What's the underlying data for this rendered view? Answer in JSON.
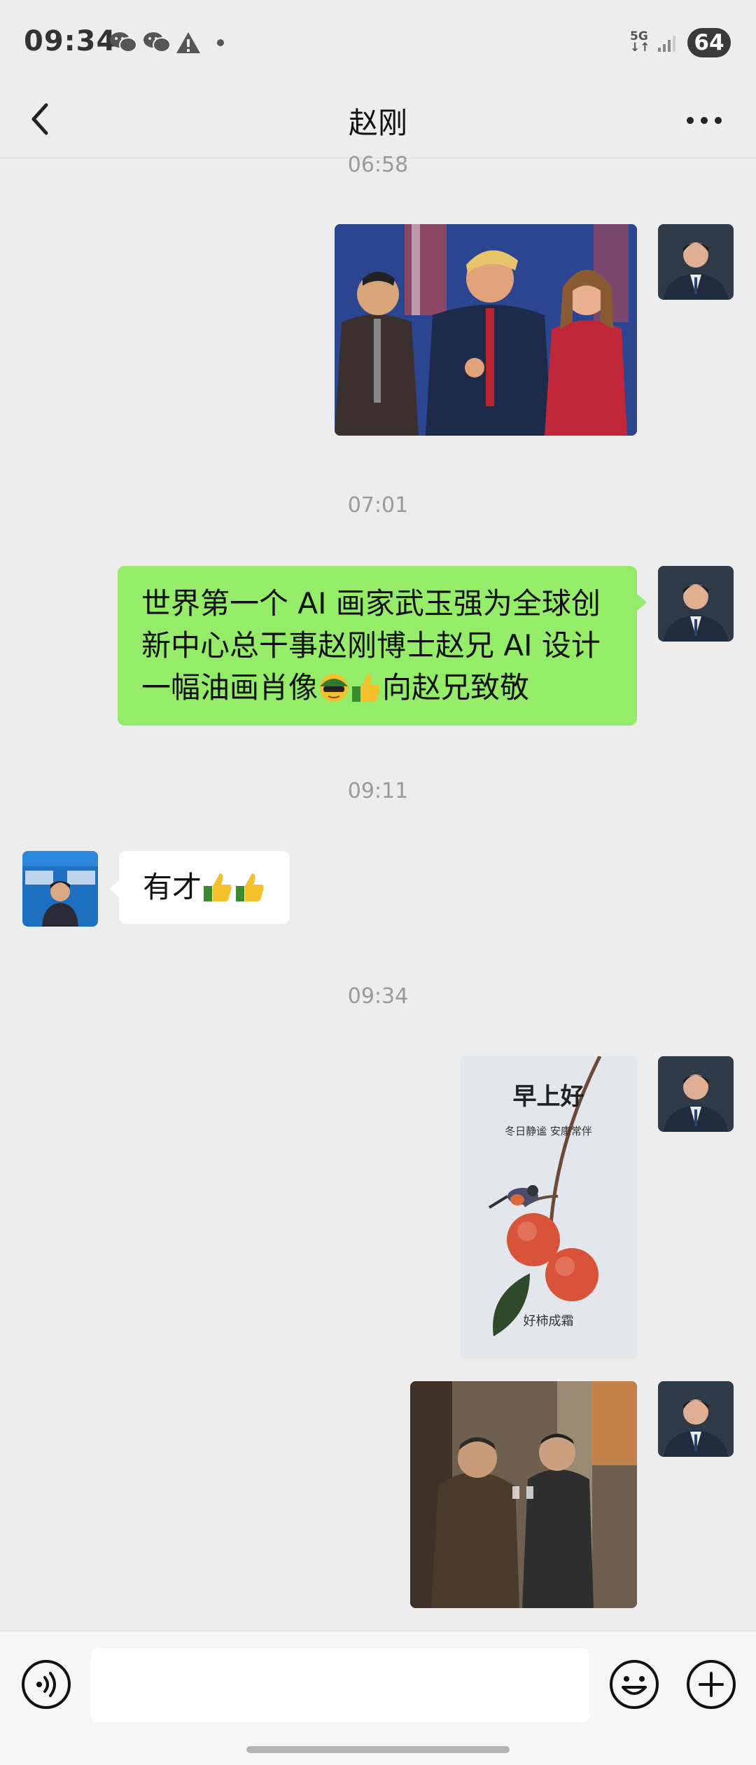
{
  "status_bar": {
    "time": "09:34",
    "network": "5G",
    "battery": "64",
    "icons": [
      "wechat-icon",
      "wechat-icon",
      "warning-icon",
      "dot-icon",
      "signal-icon"
    ]
  },
  "header": {
    "title": "赵刚",
    "back_icon": "chevron-left-icon",
    "more_icon": "more-dots-icon"
  },
  "messages": [
    {
      "type": "timestamp",
      "text": "06:58"
    },
    {
      "type": "image",
      "sender": "me",
      "depicts": "oil-painting-portrait"
    },
    {
      "type": "timestamp",
      "text": "07:01"
    },
    {
      "type": "text",
      "sender": "me",
      "lines": [
        "世界第一个 AI 画家武玉强为全球创",
        "新中心总干事赵刚博士赵兄 AI 设计",
        "一幅油画肖像"
      ],
      "tail": "向赵兄致敬",
      "emojis": [
        "sunglasses-emoji",
        "thumbs-up-emoji"
      ]
    },
    {
      "type": "timestamp",
      "text": "09:11"
    },
    {
      "type": "text",
      "sender": "them",
      "text": "有才",
      "emojis": [
        "thumbs-up-emoji",
        "thumbs-up-emoji"
      ]
    },
    {
      "type": "timestamp",
      "text": "09:34"
    },
    {
      "type": "image",
      "sender": "me",
      "depicts": "persimmon-greeting-card",
      "card_title": "早上好",
      "card_subtitle": "冬日静谧 安康常伴",
      "card_footer": "好柿成霜"
    },
    {
      "type": "image",
      "sender": "me",
      "depicts": "historic-toast-photo"
    }
  ],
  "input_bar": {
    "voice_icon": "voice-icon",
    "text_value": "",
    "emoji_icon": "smiley-icon",
    "plus_icon": "plus-icon"
  },
  "colors": {
    "background": "#ededed",
    "my_bubble": "#95ec69",
    "their_bubble": "#ffffff",
    "timestamp": "#9a9a9a"
  }
}
